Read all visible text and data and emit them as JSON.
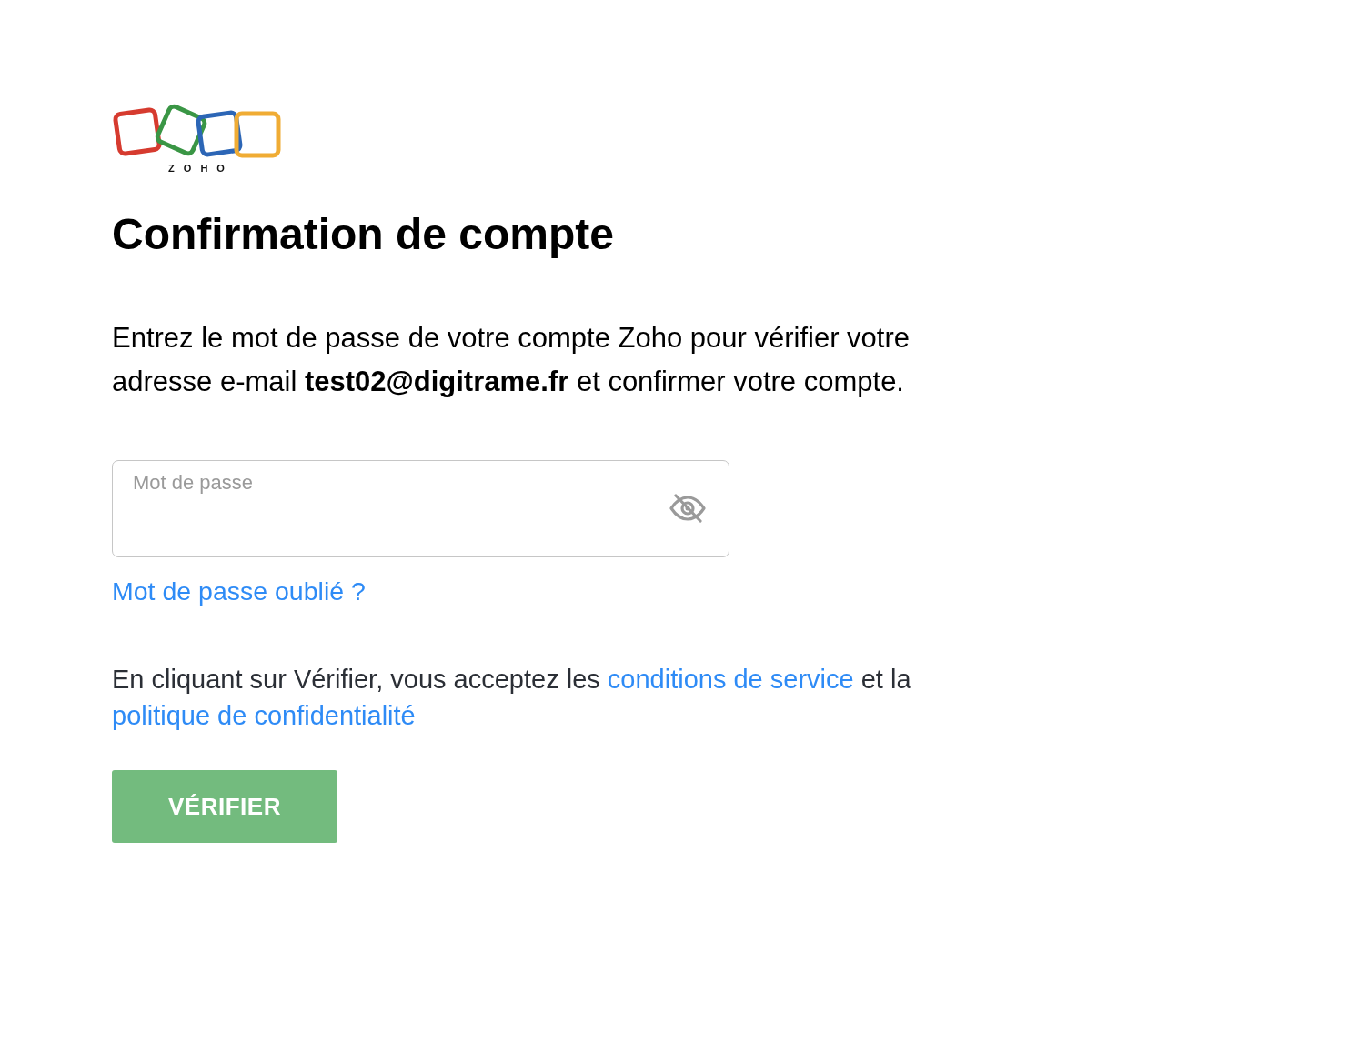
{
  "logo": {
    "text": "ZOHO"
  },
  "title": "Confirmation de compte",
  "description": "Entrez le mot de passe de votre compte Zoho pour vérifier votre adresse e-mail **test02@digitrame.fr** et confirmer votre compte.",
  "password_field": {
    "placeholder": "Mot de passe"
  },
  "forgot_password_link": "Mot de passe oublié ?",
  "terms": {
    "parts": [
      {
        "kind": "text",
        "text": "En cliquant sur Vérifier, vous acceptez les "
      },
      {
        "kind": "link",
        "text": "conditions de service"
      },
      {
        "kind": "text",
        "text": " et la "
      },
      {
        "kind": "link",
        "text": "politique de confidentialité"
      }
    ]
  },
  "verify_button": {
    "label": "VÉRIFIER"
  }
}
